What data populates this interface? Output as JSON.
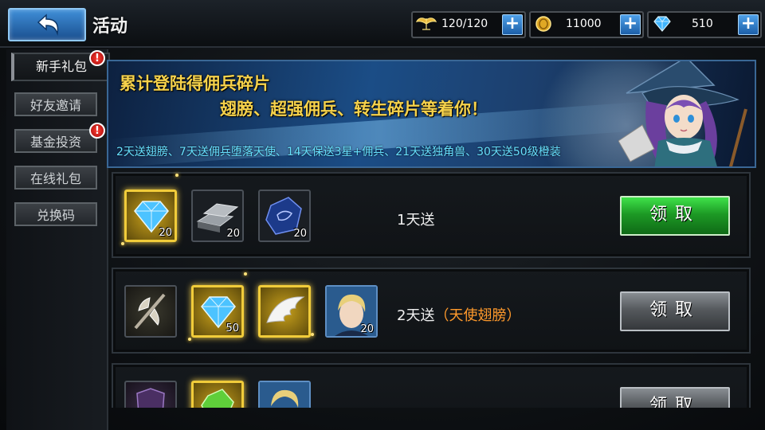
{
  "header": {
    "title": "活动",
    "resources": [
      {
        "icon": "stamina-wings-icon",
        "value": "120/120"
      },
      {
        "icon": "gold-coin-icon",
        "value": "11000"
      },
      {
        "icon": "diamond-icon",
        "value": "510"
      }
    ],
    "plus_label": "+"
  },
  "sidebar": {
    "items": [
      {
        "label": "新手礼包",
        "active": true,
        "alert": true
      },
      {
        "label": "好友邀请",
        "active": false,
        "alert": false
      },
      {
        "label": "基金投资",
        "active": false,
        "alert": true
      },
      {
        "label": "在线礼包",
        "active": false,
        "alert": false
      },
      {
        "label": "兑换码",
        "active": false,
        "alert": false
      }
    ],
    "alert_mark": "!"
  },
  "banner": {
    "line1": "累计登陆得佣兵碎片",
    "line2": "翅膀、超强佣兵、转生碎片等着你！",
    "line3": "2天送翅膀、7天送佣兵堕落天使、14天保送3星+佣兵、21天送独角兽、30天送50级橙装"
  },
  "rewards": [
    {
      "day_label": "1天送",
      "extra": "",
      "button": "领取",
      "button_state": "active",
      "items": [
        {
          "icon": "blue-diamond-icon",
          "qty": "20",
          "highlight": true
        },
        {
          "icon": "iron-ingot-icon",
          "qty": "20",
          "highlight": false
        },
        {
          "icon": "rune-stone-icon",
          "qty": "20",
          "highlight": false
        }
      ]
    },
    {
      "day_label": "2天送",
      "extra": "（天使翅膀）",
      "button": "领取",
      "button_state": "disabled",
      "items": [
        {
          "icon": "battle-axe-icon",
          "qty": "",
          "highlight": false
        },
        {
          "icon": "blue-diamond-icon",
          "qty": "50",
          "highlight": true
        },
        {
          "icon": "angel-wings-icon",
          "qty": "",
          "highlight": true
        },
        {
          "icon": "hero-portrait-icon",
          "qty": "20",
          "highlight": false
        }
      ]
    },
    {
      "day_label": "",
      "extra": "",
      "button": "领取",
      "button_state": "disabled",
      "items": [
        {
          "icon": "dark-armor-icon",
          "qty": "",
          "highlight": false
        },
        {
          "icon": "green-crystal-icon",
          "qty": "",
          "highlight": true
        },
        {
          "icon": "hero-portrait-icon",
          "qty": "",
          "highlight": false
        }
      ]
    }
  ]
}
